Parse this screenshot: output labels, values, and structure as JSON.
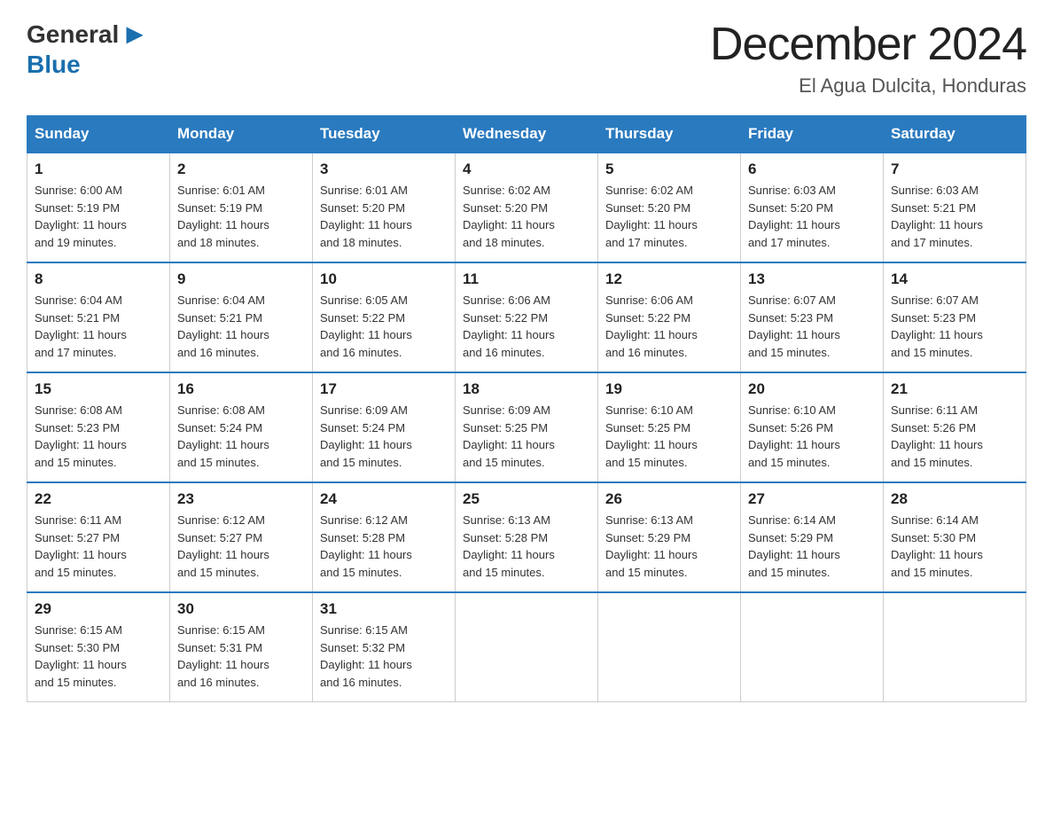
{
  "header": {
    "logo_general": "General",
    "logo_blue": "Blue",
    "month_title": "December 2024",
    "location": "El Agua Dulcita, Honduras"
  },
  "days_of_week": [
    "Sunday",
    "Monday",
    "Tuesday",
    "Wednesday",
    "Thursday",
    "Friday",
    "Saturday"
  ],
  "weeks": [
    [
      {
        "day": "1",
        "sunrise": "6:00 AM",
        "sunset": "5:19 PM",
        "daylight": "11 hours and 19 minutes."
      },
      {
        "day": "2",
        "sunrise": "6:01 AM",
        "sunset": "5:19 PM",
        "daylight": "11 hours and 18 minutes."
      },
      {
        "day": "3",
        "sunrise": "6:01 AM",
        "sunset": "5:20 PM",
        "daylight": "11 hours and 18 minutes."
      },
      {
        "day": "4",
        "sunrise": "6:02 AM",
        "sunset": "5:20 PM",
        "daylight": "11 hours and 18 minutes."
      },
      {
        "day": "5",
        "sunrise": "6:02 AM",
        "sunset": "5:20 PM",
        "daylight": "11 hours and 17 minutes."
      },
      {
        "day": "6",
        "sunrise": "6:03 AM",
        "sunset": "5:20 PM",
        "daylight": "11 hours and 17 minutes."
      },
      {
        "day": "7",
        "sunrise": "6:03 AM",
        "sunset": "5:21 PM",
        "daylight": "11 hours and 17 minutes."
      }
    ],
    [
      {
        "day": "8",
        "sunrise": "6:04 AM",
        "sunset": "5:21 PM",
        "daylight": "11 hours and 17 minutes."
      },
      {
        "day": "9",
        "sunrise": "6:04 AM",
        "sunset": "5:21 PM",
        "daylight": "11 hours and 16 minutes."
      },
      {
        "day": "10",
        "sunrise": "6:05 AM",
        "sunset": "5:22 PM",
        "daylight": "11 hours and 16 minutes."
      },
      {
        "day": "11",
        "sunrise": "6:06 AM",
        "sunset": "5:22 PM",
        "daylight": "11 hours and 16 minutes."
      },
      {
        "day": "12",
        "sunrise": "6:06 AM",
        "sunset": "5:22 PM",
        "daylight": "11 hours and 16 minutes."
      },
      {
        "day": "13",
        "sunrise": "6:07 AM",
        "sunset": "5:23 PM",
        "daylight": "11 hours and 15 minutes."
      },
      {
        "day": "14",
        "sunrise": "6:07 AM",
        "sunset": "5:23 PM",
        "daylight": "11 hours and 15 minutes."
      }
    ],
    [
      {
        "day": "15",
        "sunrise": "6:08 AM",
        "sunset": "5:23 PM",
        "daylight": "11 hours and 15 minutes."
      },
      {
        "day": "16",
        "sunrise": "6:08 AM",
        "sunset": "5:24 PM",
        "daylight": "11 hours and 15 minutes."
      },
      {
        "day": "17",
        "sunrise": "6:09 AM",
        "sunset": "5:24 PM",
        "daylight": "11 hours and 15 minutes."
      },
      {
        "day": "18",
        "sunrise": "6:09 AM",
        "sunset": "5:25 PM",
        "daylight": "11 hours and 15 minutes."
      },
      {
        "day": "19",
        "sunrise": "6:10 AM",
        "sunset": "5:25 PM",
        "daylight": "11 hours and 15 minutes."
      },
      {
        "day": "20",
        "sunrise": "6:10 AM",
        "sunset": "5:26 PM",
        "daylight": "11 hours and 15 minutes."
      },
      {
        "day": "21",
        "sunrise": "6:11 AM",
        "sunset": "5:26 PM",
        "daylight": "11 hours and 15 minutes."
      }
    ],
    [
      {
        "day": "22",
        "sunrise": "6:11 AM",
        "sunset": "5:27 PM",
        "daylight": "11 hours and 15 minutes."
      },
      {
        "day": "23",
        "sunrise": "6:12 AM",
        "sunset": "5:27 PM",
        "daylight": "11 hours and 15 minutes."
      },
      {
        "day": "24",
        "sunrise": "6:12 AM",
        "sunset": "5:28 PM",
        "daylight": "11 hours and 15 minutes."
      },
      {
        "day": "25",
        "sunrise": "6:13 AM",
        "sunset": "5:28 PM",
        "daylight": "11 hours and 15 minutes."
      },
      {
        "day": "26",
        "sunrise": "6:13 AM",
        "sunset": "5:29 PM",
        "daylight": "11 hours and 15 minutes."
      },
      {
        "day": "27",
        "sunrise": "6:14 AM",
        "sunset": "5:29 PM",
        "daylight": "11 hours and 15 minutes."
      },
      {
        "day": "28",
        "sunrise": "6:14 AM",
        "sunset": "5:30 PM",
        "daylight": "11 hours and 15 minutes."
      }
    ],
    [
      {
        "day": "29",
        "sunrise": "6:15 AM",
        "sunset": "5:30 PM",
        "daylight": "11 hours and 15 minutes."
      },
      {
        "day": "30",
        "sunrise": "6:15 AM",
        "sunset": "5:31 PM",
        "daylight": "11 hours and 16 minutes."
      },
      {
        "day": "31",
        "sunrise": "6:15 AM",
        "sunset": "5:32 PM",
        "daylight": "11 hours and 16 minutes."
      },
      null,
      null,
      null,
      null
    ]
  ],
  "labels": {
    "sunrise": "Sunrise:",
    "sunset": "Sunset:",
    "daylight": "Daylight:"
  }
}
